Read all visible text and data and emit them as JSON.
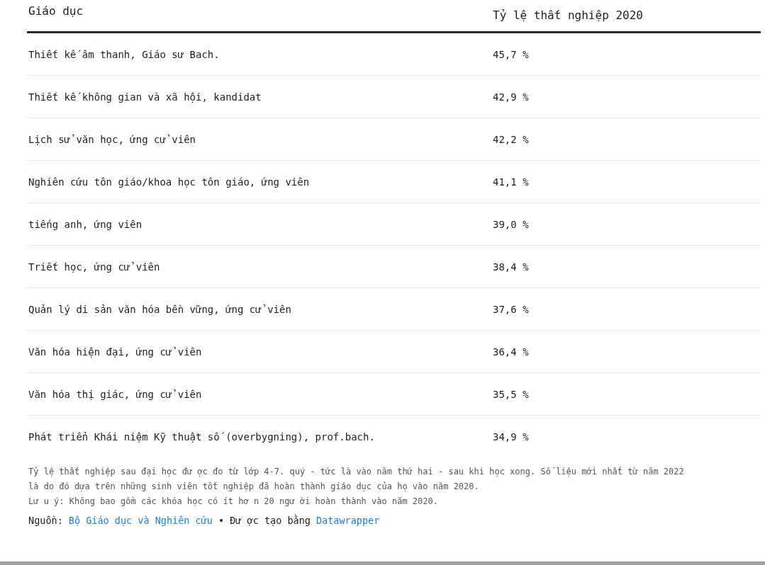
{
  "table": {
    "columns": [
      "Giáo dục",
      "Tỷ lệ thất nghiệp 2020"
    ],
    "rows": [
      {
        "education": "Thiết kế âm thanh, Giáo sư  Bach.",
        "rate": "45,7 %"
      },
      {
        "education": "Thiết kế không gian và xã hội, kandidat",
        "rate": "42,9 %"
      },
      {
        "education": "Lịch sử văn học, ứng cử viên",
        "rate": "42,2 %"
      },
      {
        "education": "Nghiên cứu tôn giáo/khoa học tôn giáo, ứng viên",
        "rate": "41,1 %"
      },
      {
        "education": "tiếng anh, ứng viên",
        "rate": "39,0 %"
      },
      {
        "education": "Triết học, ứng cử viên",
        "rate": "38,4 %"
      },
      {
        "education": "Quản lý di sản văn hóa bền vững, ứng cử viên",
        "rate": "37,6 %"
      },
      {
        "education": "Văn hóa hiện đại, ứng cử viên",
        "rate": "36,4 %"
      },
      {
        "education": "Văn hóa thị giác, ứng cử viên",
        "rate": "35,5 %"
      },
      {
        "education": "Phát triển Khái niệm Kỹ thuật số (overbygning), prof.bach.",
        "rate": "34,9 %"
      }
    ]
  },
  "notes": [
    "Tỷ lệ thất nghiệp sau đại học đư ợc đo từ lớp 4-7. quý - tức là vào năm thứ hai - sau khi học xong. Số liệu mới nhất từ năm 2022 là do đó dựa trên những sinh viên tốt nghiệp đã hoàn thành giáo dục của họ vào năm 2020.",
    "Lư u ý: Không bao gồm các khóa học có ít hơ n 20 ngư ời hoàn thành vào năm 2020."
  ],
  "source": {
    "label": "Nguồn:",
    "link": "Bộ Giáo dục và Nghiên cứu",
    "separator": "•",
    "created_by": "Đư ợc tạo bằng",
    "tool_link": "Datawrapper"
  }
}
